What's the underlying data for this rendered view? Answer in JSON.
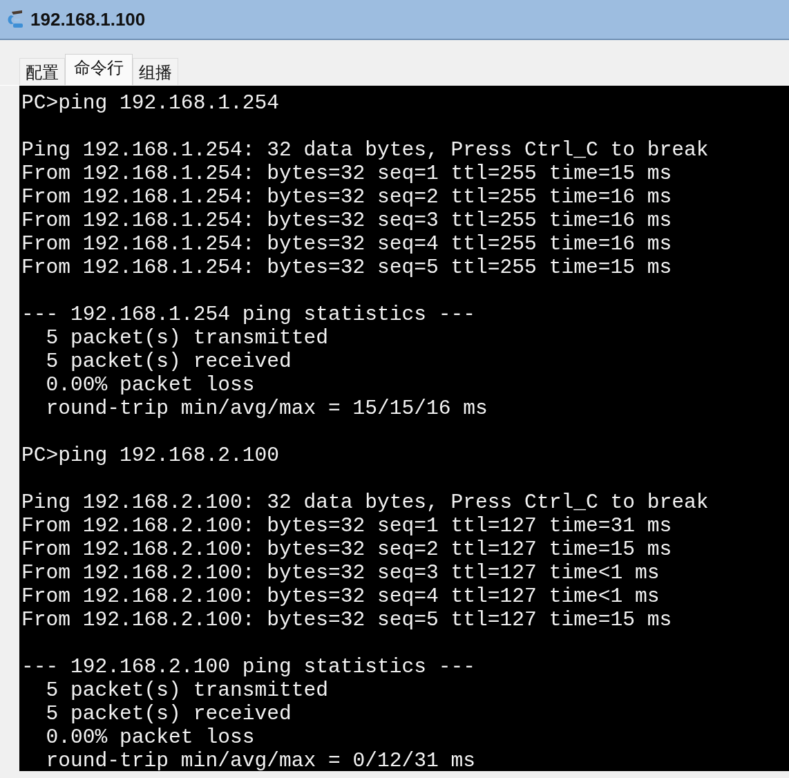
{
  "window": {
    "title": "192.168.1.100"
  },
  "tabs": [
    {
      "label": "配置",
      "selected": false
    },
    {
      "label": "命令行",
      "selected": true
    },
    {
      "label": "组播",
      "selected": false
    }
  ],
  "terminal": {
    "blocks": [
      [
        "PC>ping 192.168.1.254"
      ],
      [
        "Ping 192.168.1.254: 32 data bytes, Press Ctrl_C to break",
        "From 192.168.1.254: bytes=32 seq=1 ttl=255 time=15 ms",
        "From 192.168.1.254: bytes=32 seq=2 ttl=255 time=16 ms",
        "From 192.168.1.254: bytes=32 seq=3 ttl=255 time=16 ms",
        "From 192.168.1.254: bytes=32 seq=4 ttl=255 time=16 ms",
        "From 192.168.1.254: bytes=32 seq=5 ttl=255 time=15 ms"
      ],
      [
        "--- 192.168.1.254 ping statistics ---",
        "  5 packet(s) transmitted",
        "  5 packet(s) received",
        "  0.00% packet loss",
        "  round-trip min/avg/max = 15/15/16 ms"
      ],
      [
        "PC>ping 192.168.2.100"
      ],
      [
        "Ping 192.168.2.100: 32 data bytes, Press Ctrl_C to break",
        "From 192.168.2.100: bytes=32 seq=1 ttl=127 time=31 ms",
        "From 192.168.2.100: bytes=32 seq=2 ttl=127 time=15 ms",
        "From 192.168.2.100: bytes=32 seq=3 ttl=127 time<1 ms",
        "From 192.168.2.100: bytes=32 seq=4 ttl=127 time<1 ms",
        "From 192.168.2.100: bytes=32 seq=5 ttl=127 time=15 ms"
      ],
      [
        "--- 192.168.2.100 ping statistics ---",
        "  5 packet(s) transmitted",
        "  5 packet(s) received",
        "  0.00% packet loss",
        "  round-trip min/avg/max = 0/12/31 ms"
      ]
    ]
  }
}
